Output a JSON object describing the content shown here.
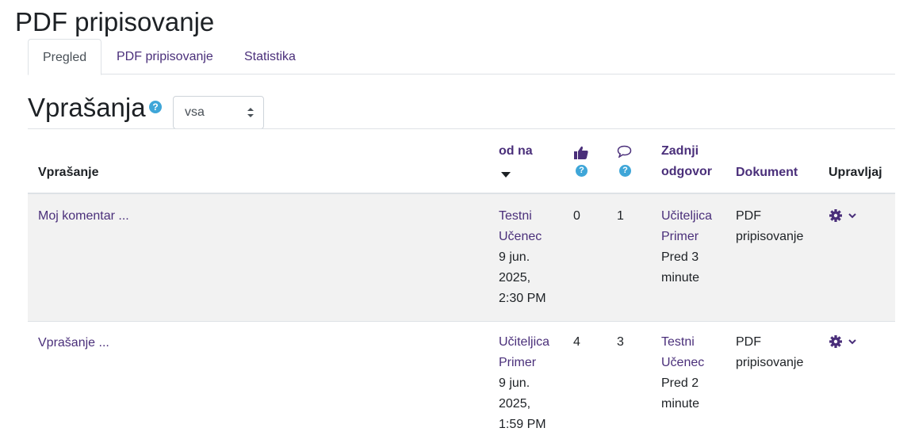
{
  "page": {
    "title": "PDF pripisovanje"
  },
  "tabs": [
    {
      "label": "Pregled",
      "active": true
    },
    {
      "label": "PDF pripisovanje",
      "active": false
    },
    {
      "label": "Statistika",
      "active": false
    }
  ],
  "section": {
    "title": "Vprašanja",
    "help_icon": "help-icon",
    "filter": {
      "selected": "vsa"
    }
  },
  "table": {
    "headers": {
      "question": "Vprašanje",
      "from_line1": "od na",
      "likes_icon": "thumbs-up-icon",
      "comments_icon": "comment-icon",
      "last_reply_line1": "Zadnji",
      "last_reply_line2": "odgovor",
      "document": "Dokument",
      "manage": "Upravljaj"
    },
    "rows": [
      {
        "question": "Moj komentar ...",
        "author_line1": "Testni",
        "author_line2": "Učenec",
        "date_line1": "9 jun.",
        "date_line2": "2025,",
        "date_line3": "2:30 PM",
        "likes": "0",
        "comments": "1",
        "last_author_line1": "Učiteljica",
        "last_author_line2": "Primer",
        "last_time_line1": "Pred 3",
        "last_time_line2": "minute",
        "document_line1": "PDF",
        "document_line2": "pripisovanje"
      },
      {
        "question": "Vprašanje ...",
        "author_line1": "Učiteljica",
        "author_line2": "Primer",
        "date_line1": "9 jun.",
        "date_line2": "2025,",
        "date_line3": "1:59 PM",
        "likes": "4",
        "comments": "3",
        "last_author_line1": "Testni",
        "last_author_line2": "Učenec",
        "last_time_line1": "Pred 2",
        "last_time_line2": "minute",
        "document_line1": "PDF",
        "document_line2": "pripisovanje"
      }
    ]
  },
  "colors": {
    "link": "#4a2f7a",
    "help": "#3fa6d8",
    "row_bg": "#f2f2f2"
  }
}
